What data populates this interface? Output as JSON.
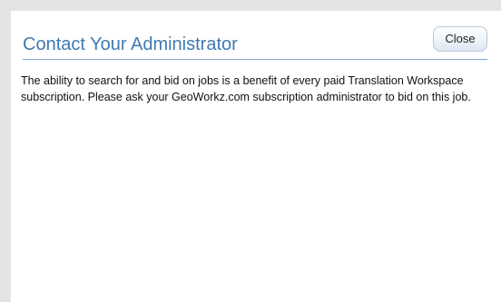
{
  "dialog": {
    "title": "Contact Your Administrator",
    "close_label": "Close",
    "message": "The ability to search for and bid on jobs is a benefit of every paid Translation Workspace subscription. Please ask your GeoWorkz.com subscription administrator to bid on this job."
  },
  "colors": {
    "title": "#3f7ab1",
    "rule": "#7ea7cf",
    "background": "#e4e4e4"
  }
}
